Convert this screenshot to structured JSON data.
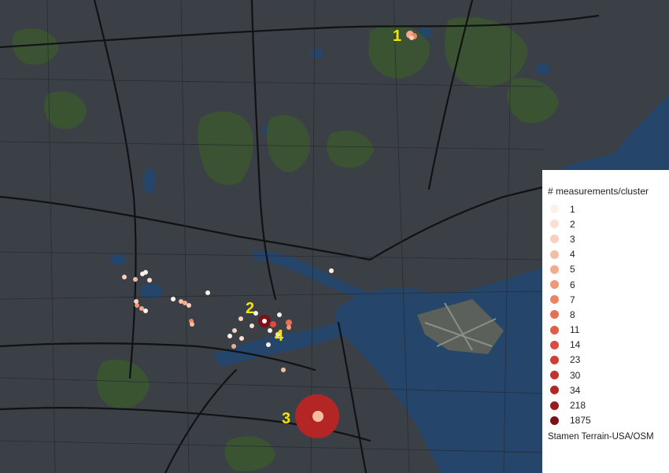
{
  "map": {
    "basemap": "Stamen Terrain-USA/OSM",
    "colors": {
      "land": "#3b4046",
      "water": "#25466a",
      "park": "#3b5630",
      "road": "#101214",
      "airport": "#5b605a"
    },
    "cluster_labels": [
      "1",
      "2",
      "3",
      "4"
    ]
  },
  "legend": {
    "title": "# measurements/cluster",
    "items": [
      {
        "value": "1",
        "color": "#fdf0ea"
      },
      {
        "value": "2",
        "color": "#fbe0d2"
      },
      {
        "value": "3",
        "color": "#f9d0bd"
      },
      {
        "value": "4",
        "color": "#f6bda5"
      },
      {
        "value": "5",
        "color": "#f4aa8c"
      },
      {
        "value": "6",
        "color": "#f09778"
      },
      {
        "value": "7",
        "color": "#ec8363"
      },
      {
        "value": "8",
        "color": "#e86f53"
      },
      {
        "value": "11",
        "color": "#e45b47"
      },
      {
        "value": "14",
        "color": "#de4a3d"
      },
      {
        "value": "23",
        "color": "#d33b35"
      },
      {
        "value": "30",
        "color": "#c6302d"
      },
      {
        "value": "34",
        "color": "#b42525"
      },
      {
        "value": "218",
        "color": "#9b1a1d"
      },
      {
        "value": "1875",
        "color": "#7d1015"
      }
    ],
    "credit": "Stamen Terrain-USA/OSM"
  }
}
